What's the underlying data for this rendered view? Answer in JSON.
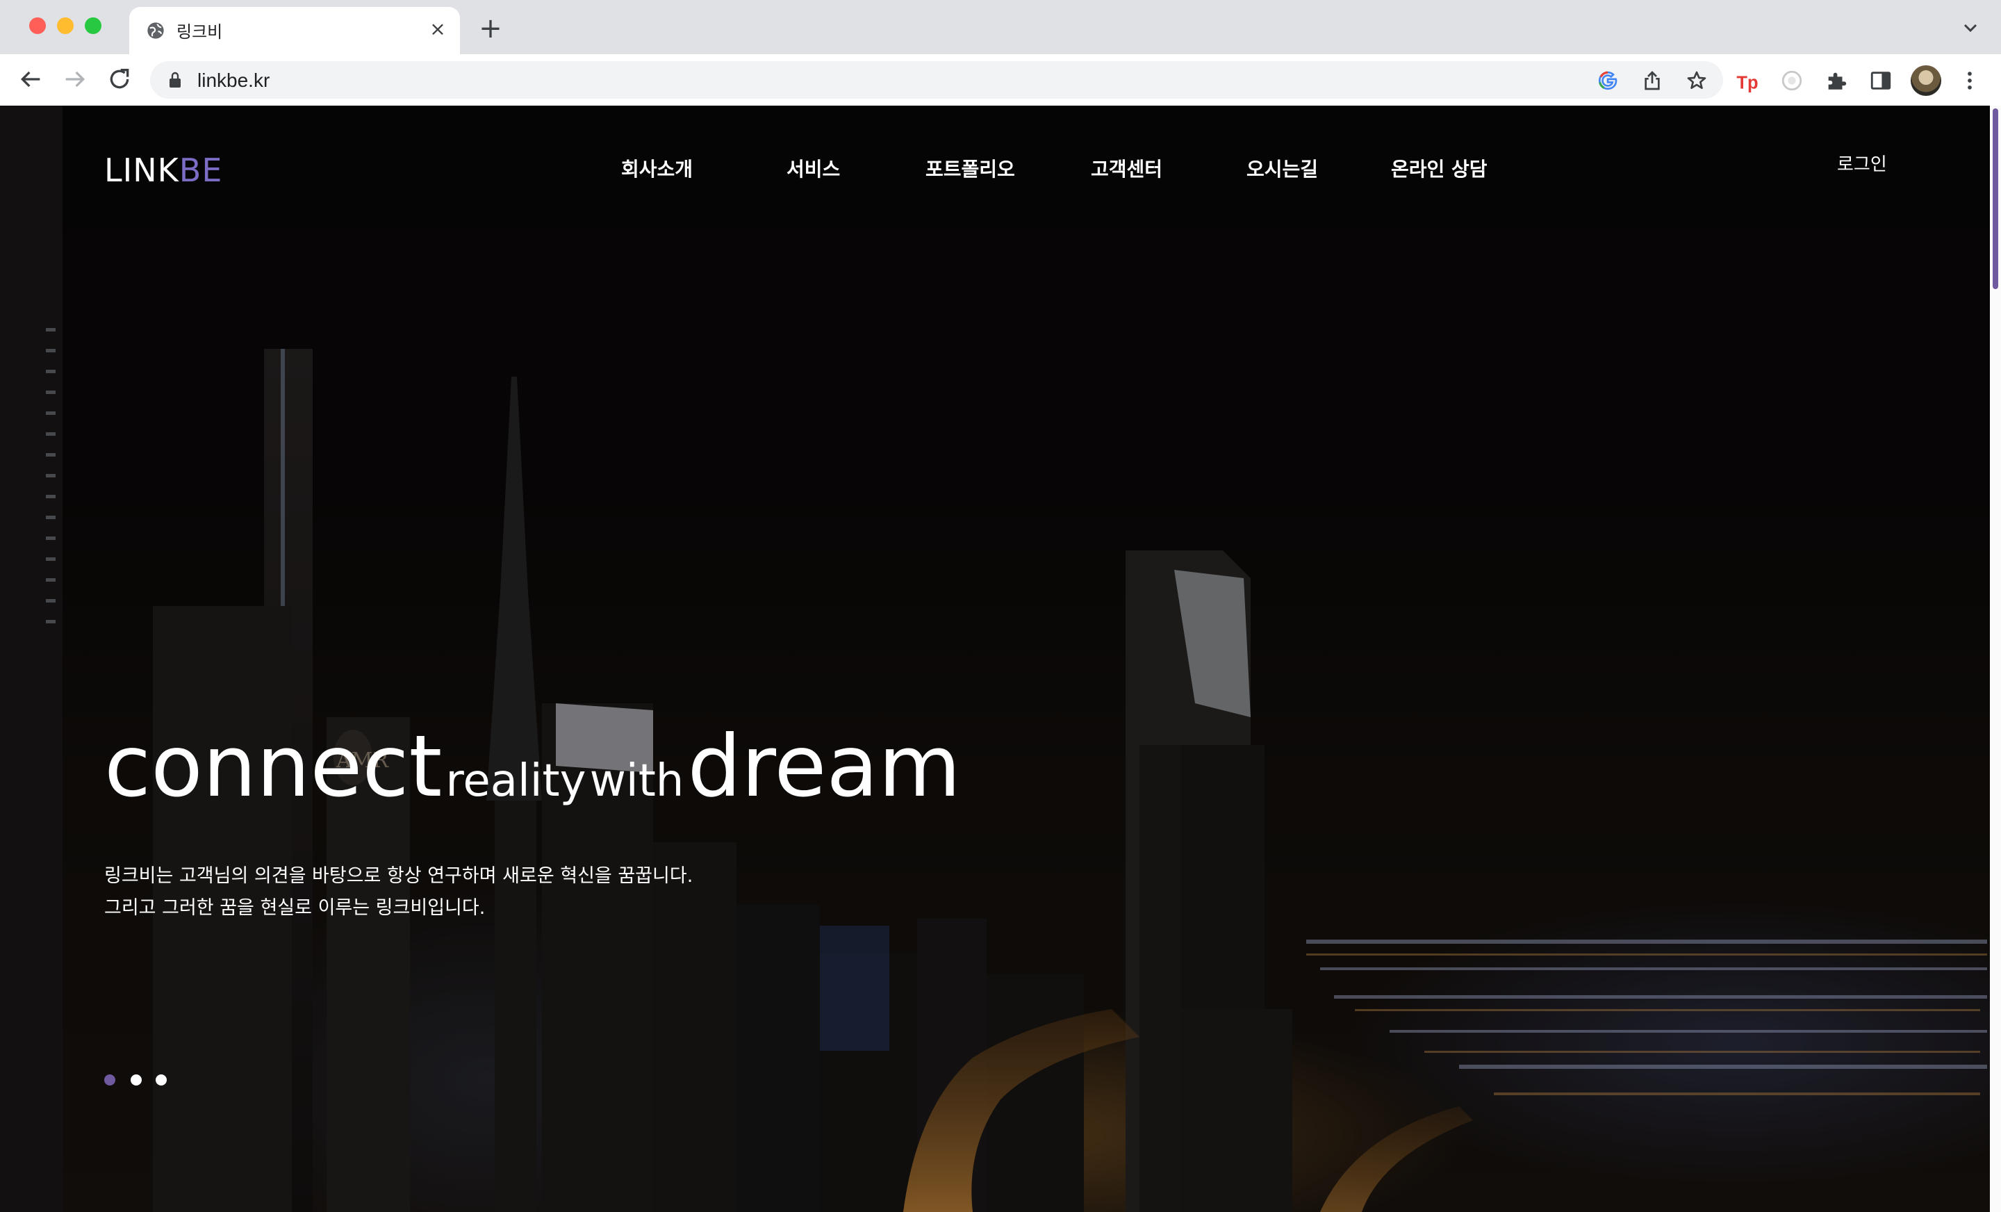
{
  "browser": {
    "tab_title": "링크비",
    "tab_close": "×",
    "new_tab": "+",
    "url": "linkbe.kr"
  },
  "site": {
    "logo_link": "LINK",
    "logo_be": "BE",
    "nav": [
      "회사소개",
      "서비스",
      "포트폴리오",
      "고객센터",
      "오시는길",
      "온라인 상담"
    ],
    "login": "로그인"
  },
  "hero": {
    "word_connect": "connect",
    "word_reality": "reality",
    "word_with": "with",
    "word_dream": "dream",
    "line1": "링크비는 고객님의 의견을 바탕으로 항상 연구하며 새로운 혁신을 꿈꿉니다.",
    "line2": "그리고 그러한 꿈을 현실로 이루는 링크비입니다.",
    "slides": 3,
    "active_slide": 1
  },
  "colors": {
    "accent": "#7c6cc4",
    "dot_active": "#6f5aa0",
    "dot_inactive": "#ffffff"
  }
}
